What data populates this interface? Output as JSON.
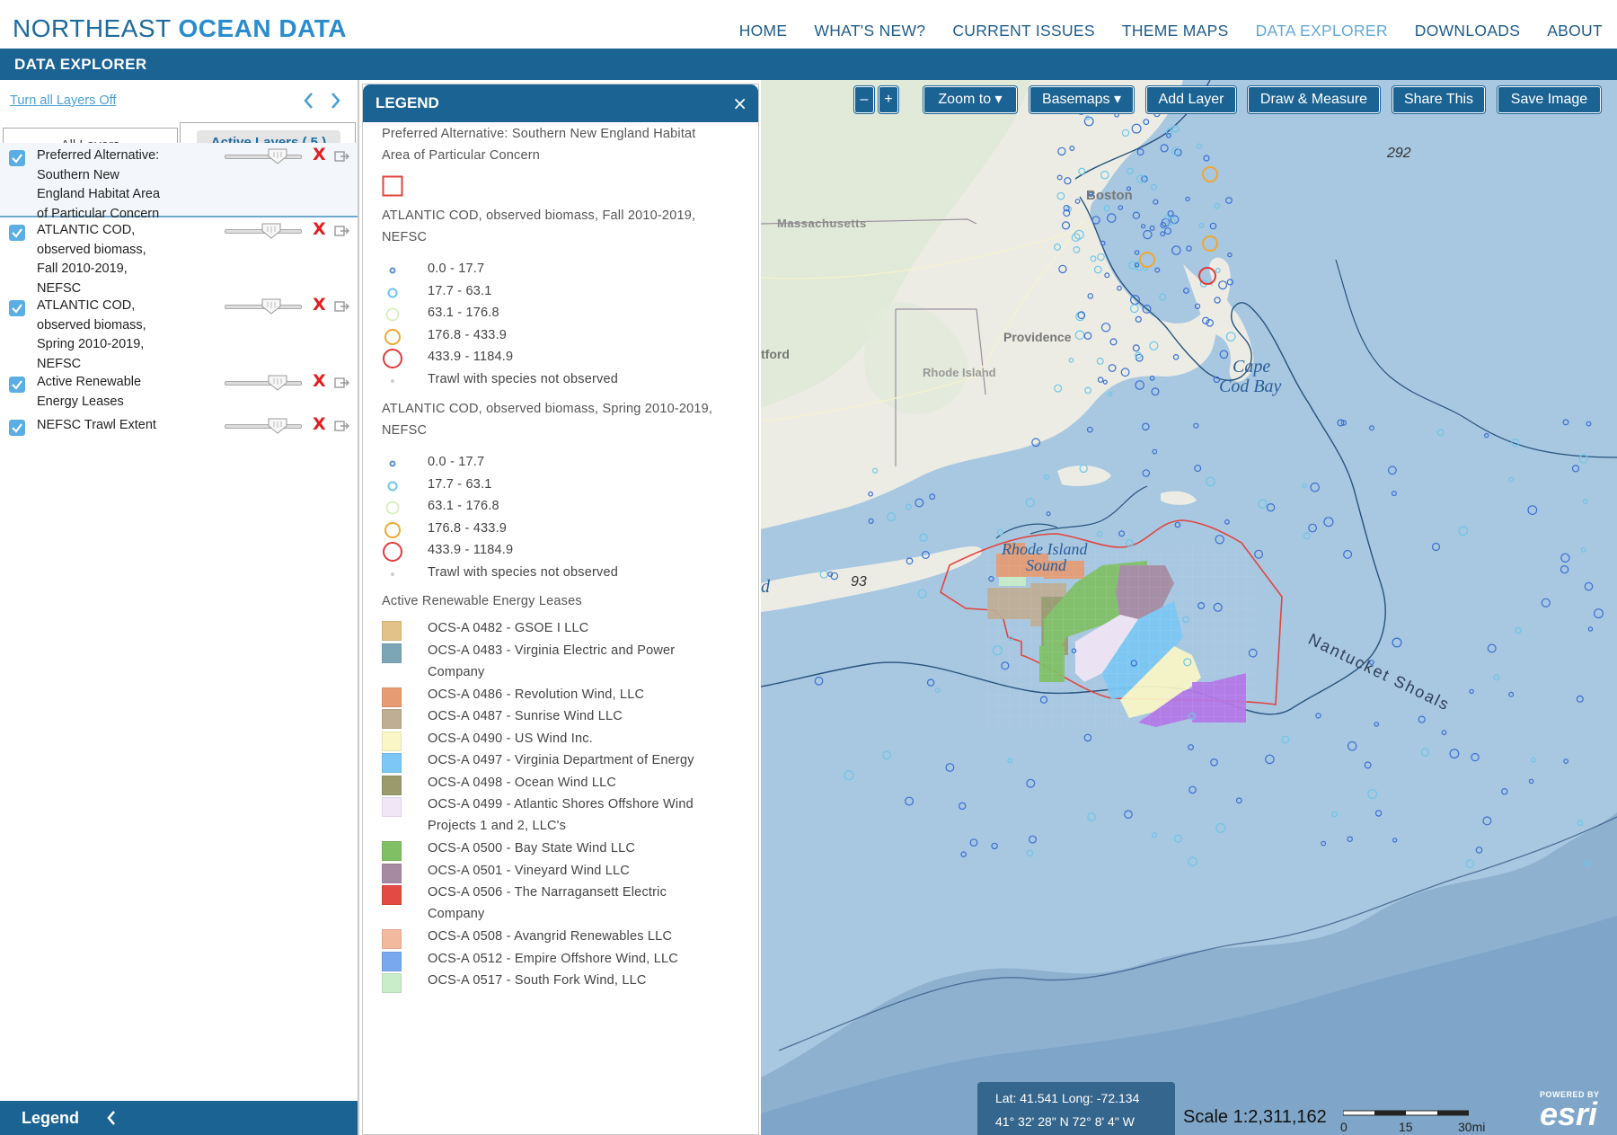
{
  "header": {
    "logo_part1": "NORTHEAST ",
    "logo_part2": "OCEAN DATA",
    "nav": [
      {
        "label": "HOME",
        "active": false
      },
      {
        "label": "WHAT'S NEW?",
        "active": false
      },
      {
        "label": "CURRENT ISSUES",
        "active": false
      },
      {
        "label": "THEME MAPS",
        "active": false
      },
      {
        "label": "DATA EXPLORER",
        "active": true
      },
      {
        "label": "DOWNLOADS",
        "active": false
      },
      {
        "label": "ABOUT",
        "active": false
      }
    ]
  },
  "title_bar": "DATA EXPLORER",
  "layers_panel": {
    "turn_off_link": "Turn all Layers Off",
    "tab_all": "All Layers",
    "tab_active": "Active Layers ( 5 )",
    "layers": [
      {
        "lines": [
          "Preferred Alternative:",
          "Southern New",
          "England Habitat Area",
          "of Particular Concern"
        ],
        "checked": true,
        "opacity": 0.75
      },
      {
        "lines": [
          "ATLANTIC COD,",
          "observed biomass,",
          "Fall 2010-2019,",
          "NEFSC"
        ],
        "checked": true,
        "opacity": 0.65
      },
      {
        "lines": [
          "ATLANTIC COD,",
          "observed biomass,",
          "Spring 2010-2019,",
          "NEFSC"
        ],
        "checked": true,
        "opacity": 0.65
      },
      {
        "lines": [
          "Active Renewable",
          "Energy Leases"
        ],
        "checked": true,
        "opacity": 0.75
      },
      {
        "lines": [
          "NEFSC Trawl Extent"
        ],
        "checked": true,
        "opacity": 0.75
      }
    ],
    "footer_label": "Legend"
  },
  "legend": {
    "title": "LEGEND",
    "close": "×",
    "habitat_title": [
      "Preferred Alternative: Southern New England Habitat",
      "Area of Particular Concern"
    ],
    "fall_title": [
      "ATLANTIC COD, observed biomass, Fall 2010-2019,",
      "NEFSC"
    ],
    "spring_title": [
      "ATLANTIC COD, observed biomass, Spring 2010-2019,",
      "NEFSC"
    ],
    "biomass_classes": [
      {
        "label": "0.0 - 17.7",
        "color": "#5b8fd6",
        "size": "tiny"
      },
      {
        "label": "17.7 - 63.1",
        "color": "#6ec6e8",
        "size": "small"
      },
      {
        "label": "63.1 - 176.8",
        "color": "#d8f0c0",
        "size": "medium"
      },
      {
        "label": "176.8 - 433.9",
        "color": "#f0a830",
        "size": "large"
      },
      {
        "label": "433.9 - 1184.9",
        "color": "#e03c3c",
        "size": "xlarge"
      },
      {
        "label": "Trawl with species not observed",
        "color": "#cfcfcf",
        "size": "dot"
      }
    ],
    "leases_title": "Active Renewable Energy Leases",
    "leases": [
      {
        "label": [
          "OCS-A 0482 - GSOE I LLC"
        ],
        "color": "#e3c28a"
      },
      {
        "label": [
          "OCS-A 0483 - Virginia Electric and Power",
          "Company"
        ],
        "color": "#7ca6b6"
      },
      {
        "label": [
          "OCS-A 0486 - Revolution Wind, LLC"
        ],
        "color": "#e69b72"
      },
      {
        "label": [
          "OCS-A 0487 - Sunrise Wind LLC"
        ],
        "color": "#bfad94"
      },
      {
        "label": [
          "OCS-A 0490 - US Wind Inc."
        ],
        "color": "#fbf6c5"
      },
      {
        "label": [
          "OCS-A 0497 - Virginia Department of Energy"
        ],
        "color": "#7cc7f5"
      },
      {
        "label": [
          "OCS-A 0498 - Ocean Wind LLC"
        ],
        "color": "#9a9a6c"
      },
      {
        "label": [
          "OCS-A 0499 - Atlantic Shores Offshore Wind",
          "Projects 1 and 2, LLC's"
        ],
        "color": "#f1e6f6"
      },
      {
        "label": [
          "OCS-A 0500 - Bay State Wind LLC"
        ],
        "color": "#80c064"
      },
      {
        "label": [
          "OCS-A 0501 - Vineyard Wind LLC"
        ],
        "color": "#a58aa2"
      },
      {
        "label": [
          "OCS-A 0506 - The Narragansett Electric",
          "Company"
        ],
        "color": "#e34a44"
      },
      {
        "label": [
          "OCS-A 0508 - Avangrid Renewables LLC"
        ],
        "color": "#f2b99e"
      },
      {
        "label": [
          "OCS-A 0512 - Empire Offshore Wind, LLC"
        ],
        "color": "#7aa8ef"
      },
      {
        "label": [
          "OCS-A 0517 - South Fork Wind, LLC"
        ],
        "color": "#c9ecc9"
      }
    ]
  },
  "map": {
    "zoom_out": "–",
    "zoom_in": "+",
    "zoom_to": "Zoom to ▾",
    "basemaps": "Basemaps ▾",
    "add_layer": "Add Layer",
    "draw_measure": "Draw & Measure",
    "share": "Share This",
    "save_image": "Save Image",
    "labels": {
      "massachusetts": "Massachusetts",
      "boston": "Boston",
      "providence": "Providence",
      "rhode_island": "Rhode Island",
      "hartford_fragment": "tford",
      "cape": "Cape",
      "cod_bay": "Cod Bay",
      "ri_sound_1": "Rhode Island",
      "ri_sound_2": "Sound",
      "nantucket_shoals": "Nantucket Shoals",
      "depth_292": "292",
      "depth_93": "93",
      "left_fragment": "d"
    },
    "coords_line1": "Lat: 41.541 Long: -72.134",
    "coords_line2": "41° 32' 28\" N 72° 8' 4\" W",
    "scale_text": "Scale 1:2,311,162",
    "scale_ticks": [
      "0",
      "15",
      "30mi"
    ],
    "esri_powered": "POWERED BY",
    "esri": "esri"
  }
}
